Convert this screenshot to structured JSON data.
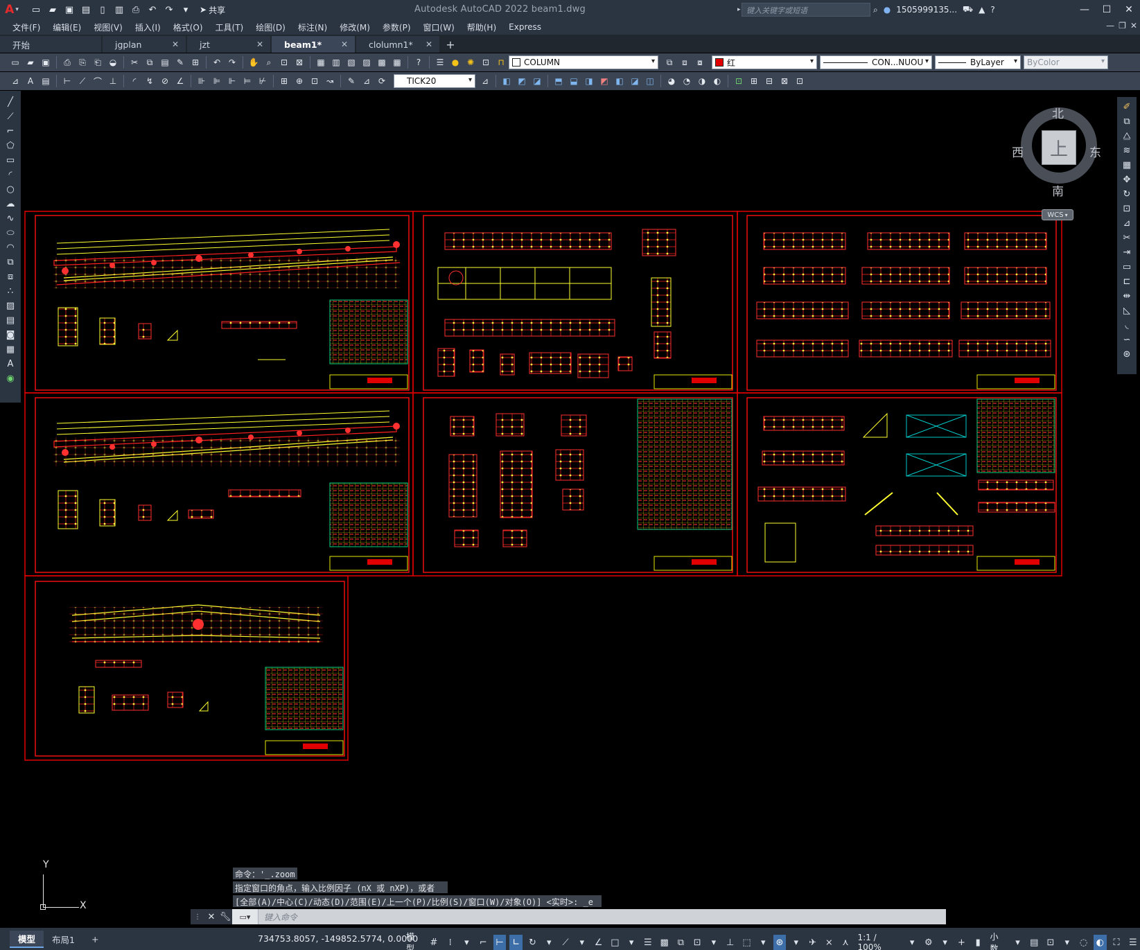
{
  "app": {
    "logo": "A",
    "title": "Autodesk AutoCAD 2022    beam1.dwg"
  },
  "quick_access": {
    "share_label": "共享",
    "icons": [
      "new-icon",
      "open-icon",
      "save-icon",
      "save-as-icon",
      "open-web-icon",
      "save-web-icon",
      "plot-icon",
      "undo-icon",
      "redo-icon",
      "customize-icon"
    ]
  },
  "search": {
    "placeholder": "键入关键字或短语"
  },
  "user": {
    "name": "1505999135..."
  },
  "menu": [
    "文件(F)",
    "编辑(E)",
    "视图(V)",
    "插入(I)",
    "格式(O)",
    "工具(T)",
    "绘图(D)",
    "标注(N)",
    "修改(M)",
    "参数(P)",
    "窗口(W)",
    "帮助(H)",
    "Express"
  ],
  "tabs": [
    {
      "label": "开始",
      "active": false,
      "closable": false
    },
    {
      "label": "jgplan",
      "active": false,
      "closable": true
    },
    {
      "label": "jzt",
      "active": false,
      "closable": true
    },
    {
      "label": "beam1*",
      "active": true,
      "closable": true
    },
    {
      "label": "clolumn1*",
      "active": false,
      "closable": true
    }
  ],
  "layer_combo": {
    "value": "COLUMN"
  },
  "color_combo": {
    "value": "红",
    "swatch": "#e00000"
  },
  "linetype_combo": {
    "value": "CON...NUOU"
  },
  "lineweight_combo": {
    "value": "ByLayer"
  },
  "plotstyle_combo": {
    "value": "ByColor"
  },
  "dimstyle_combo": {
    "value": "TICK20"
  },
  "viewcube": {
    "north": "北",
    "south": "南",
    "east": "东",
    "west": "西",
    "face": "上",
    "wcs": "WCS"
  },
  "ucs": {
    "x": "X",
    "y": "Y"
  },
  "command_history": [
    "命令：'_.zoom",
    "指定窗口的角点，输入比例因子 (nX 或 nXP)，或者",
    "[全部(A)/中心(C)/动态(D)/范围(E)/上一个(P)/比例(S)/窗口(W)/对象(O)] <实时>: _e"
  ],
  "command_input": {
    "placeholder": "键入命令"
  },
  "layout_tabs": [
    "模型",
    "布局1"
  ],
  "status": {
    "coords": "734753.8057, -149852.5774, 0.0000",
    "model_label": "模型",
    "scale": "1:1 / 100%",
    "units": "小数"
  },
  "colors": {
    "frame": "#d40000",
    "title_block": "#d4d400",
    "table": "#00c878",
    "chrome": "#2b3441"
  }
}
